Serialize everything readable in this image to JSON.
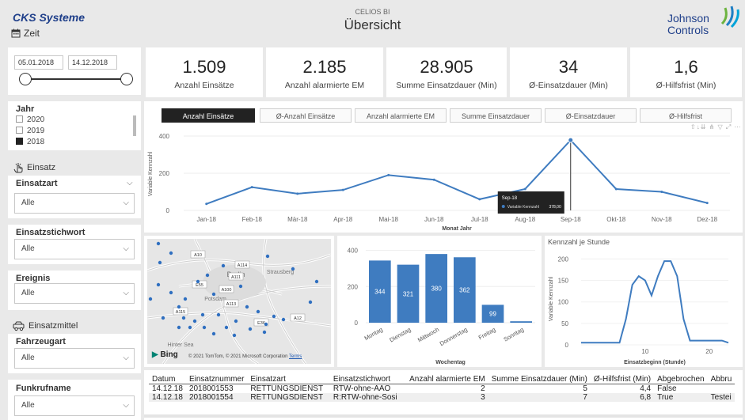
{
  "header": {
    "brand": "CKS Systeme",
    "zeit_label": "Zeit",
    "app_name": "CELIOS BI",
    "page_title": "Übersicht",
    "logo_line1": "Johnson",
    "logo_line2": "Controls"
  },
  "date_slicer": {
    "from": "05.01.2018",
    "to": "14.12.2018"
  },
  "year_slicer": {
    "title": "Jahr",
    "items": [
      {
        "label": "2020",
        "checked": false
      },
      {
        "label": "2019",
        "checked": false
      },
      {
        "label": "2018",
        "checked": true
      }
    ]
  },
  "einsatz_section": {
    "title": "Einsatz",
    "einsatzart_label": "Einsatzart",
    "einsatzart_value": "Alle"
  },
  "einsatzstichwort": {
    "label": "Einsatzstichwort",
    "value": "Alle"
  },
  "ereignis": {
    "label": "Ereignis",
    "value": "Alle"
  },
  "einsatzmittel_section": {
    "title": "Einsatzmittel",
    "fahrzeugart_label": "Fahrzeugart",
    "fahrzeugart_value": "Alle"
  },
  "funkrufname": {
    "label": "Funkrufname",
    "value": "Alle"
  },
  "kpis": [
    {
      "value": "1.509",
      "label": "Anzahl Einsätze"
    },
    {
      "value": "2.185",
      "label": "Anzahl alarmierte EM"
    },
    {
      "value": "28.905",
      "label": "Summe Einsatzdauer (Min)"
    },
    {
      "value": "34",
      "label": "Ø-Einsatzdauer (Min)"
    },
    {
      "value": "1,6",
      "label": "Ø-Hilfsfrist (Min)"
    }
  ],
  "tabs": [
    {
      "label": "Anzahl Einsätze",
      "active": true
    },
    {
      "label": "Ø-Anzahl Einsätze",
      "active": false
    },
    {
      "label": "Anzahl alarmierte EM",
      "active": false
    },
    {
      "label": "Summe Einsatzdauer",
      "active": false
    },
    {
      "label": "Ø-Einsatzdauer",
      "active": false
    },
    {
      "label": "Ø-Hilfsfrist",
      "active": false
    }
  ],
  "chart_data": [
    {
      "type": "line",
      "ylabel": "Variable Kennzahl",
      "xlabel": "Monat Jahr",
      "categories": [
        "Jan-18",
        "Feb-18",
        "Mär-18",
        "Apr-18",
        "Mai-18",
        "Jun-18",
        "Jul-18",
        "Aug-18",
        "Sep-18",
        "Okt-18",
        "Nov-18",
        "Dez-18"
      ],
      "values": [
        35,
        125,
        90,
        110,
        190,
        165,
        60,
        115,
        378,
        115,
        100,
        40
      ],
      "yticks": [
        0,
        200,
        400
      ],
      "ylim": [
        0,
        400
      ],
      "color": "#3f7cc0",
      "tooltip": {
        "title": "Sep-18",
        "series": "Variable Kennzahl",
        "value": "378,00"
      }
    },
    {
      "type": "bar",
      "xlabel": "Wochentag",
      "categories": [
        "Montag",
        "Dienstag",
        "Mittwoch",
        "Donnerstag",
        "Freitag",
        "Sonntag"
      ],
      "values": [
        344,
        321,
        380,
        362,
        99,
        8
      ],
      "labels": [
        "344",
        "321",
        "380",
        "362",
        "99",
        ""
      ],
      "yticks": [
        0,
        200,
        400
      ],
      "ylim": [
        0,
        420
      ],
      "color": "#3f7cc0"
    },
    {
      "type": "area",
      "title": "Kennzahl je Stunde",
      "ylabel": "Variable Kennzahl",
      "xlabel": "Einsatzbeginn (Stunde)",
      "x": [
        0,
        1,
        2,
        3,
        4,
        5,
        6,
        7,
        8,
        9,
        10,
        11,
        12,
        13,
        14,
        15,
        16,
        17,
        18,
        19,
        20,
        21,
        22,
        23
      ],
      "values": [
        5,
        5,
        5,
        5,
        5,
        5,
        5,
        60,
        140,
        160,
        150,
        115,
        160,
        195,
        195,
        160,
        60,
        10,
        10,
        10,
        10,
        10,
        10,
        5
      ],
      "yticks": [
        0,
        50,
        100,
        150,
        200
      ],
      "xticks": [
        10,
        20
      ],
      "ylim": [
        0,
        210
      ],
      "color": "#3f7cc0"
    }
  ],
  "map": {
    "labels": [
      "Berlin",
      "Strausberg",
      "Potsdam",
      "Hinter Sea",
      "A10",
      "A111",
      "A114",
      "A115",
      "A100",
      "A113",
      "A12",
      "E55",
      "E36"
    ],
    "attribution": "© 2021 TomTom, © 2021 Microsoft Corporation",
    "terms": "Terms",
    "bing": "Bing"
  },
  "table": {
    "columns": [
      "Datum",
      "Einsatznummer",
      "Einsatzart",
      "Einsatzstichwort",
      "Anzahl alarmierte EM",
      "Summe Einsatzdauer (Min)",
      "Ø-Hilfsfrist (Min)",
      "Abgebrochen",
      "Abbru"
    ],
    "rows": [
      [
        "14.12.18",
        "2018001553",
        "RETTUNGSDIENST",
        "RTW-ohne-AAO",
        "2",
        "5",
        "4,4",
        "False",
        ""
      ],
      [
        "14.12.18",
        "2018001554",
        "RETTUNGSDIENST",
        "R:RTW-ohne-Sosi",
        "3",
        "7",
        "6,8",
        "True",
        "Testei"
      ]
    ]
  },
  "colors": {
    "accent": "#3f7cc0",
    "brand": "#1f3f8a",
    "background": "#e9e9e9"
  }
}
